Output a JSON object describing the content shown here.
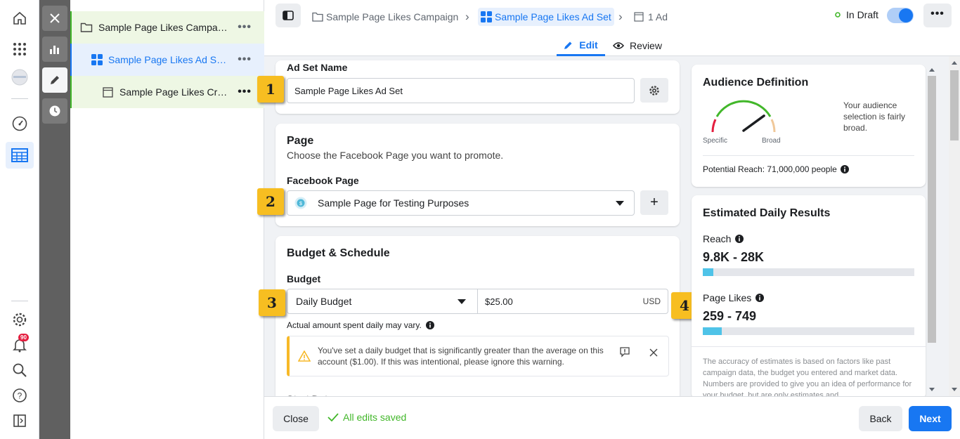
{
  "rail": {
    "notif_count": "90"
  },
  "tree": {
    "campaign": "Sample Page Likes Campa…",
    "adset": "Sample Page Likes Ad S…",
    "ad": "Sample Page Likes Cr…",
    "more": "•••"
  },
  "breadcrumb": {
    "campaign": "Sample Page Likes Campaign",
    "adset": "Sample Page Likes Ad Set",
    "ad": "1 Ad",
    "sep": "›"
  },
  "status": {
    "label": "In Draft",
    "more": "•••"
  },
  "tabs": {
    "edit": "Edit",
    "review": "Review"
  },
  "adset_name": {
    "label": "Ad Set Name",
    "value": "Sample Page Likes Ad Set"
  },
  "page_section": {
    "title": "Page",
    "desc": "Choose the Facebook Page you want to promote.",
    "fb_label": "Facebook Page",
    "fb_value": "Sample Page for Testing Purposes",
    "add": "+"
  },
  "budget": {
    "title": "Budget & Schedule",
    "label": "Budget",
    "type": "Daily Budget",
    "amount": "$25.00",
    "currency": "USD",
    "note": "Actual amount spent daily may vary.",
    "warning": "You've set a daily budget that is significantly greater than the average on this account ($1.00). If this was intentional, please ignore this warning.",
    "partial_heading": "Start Dat..."
  },
  "callouts": [
    "1",
    "2",
    "3",
    "4"
  ],
  "audience": {
    "title": "Audience Definition",
    "text": "Your audience selection is fairly broad.",
    "specific": "Specific",
    "broad": "Broad",
    "reach": "Potential Reach: 71,000,000 people",
    "gauge_level": 0.8
  },
  "estimates": {
    "title": "Estimated Daily Results",
    "reach_label": "Reach",
    "reach_value": "9.8K - 28K",
    "reach_fill": 0.05,
    "likes_label": "Page Likes",
    "likes_value": "259 - 749",
    "likes_fill": 0.09,
    "disclaimer": "The accuracy of estimates is based on factors like past campaign data, the budget you entered and market data. Numbers are provided to give you an idea of performance for your budget, but are only estimates and"
  },
  "footer": {
    "close": "Close",
    "saved": "All edits saved",
    "back": "Back",
    "next": "Next"
  },
  "colors": {
    "primary": "#1877f2",
    "green": "#42b72a",
    "warning": "#f7b928",
    "callout": "#f7be21"
  }
}
